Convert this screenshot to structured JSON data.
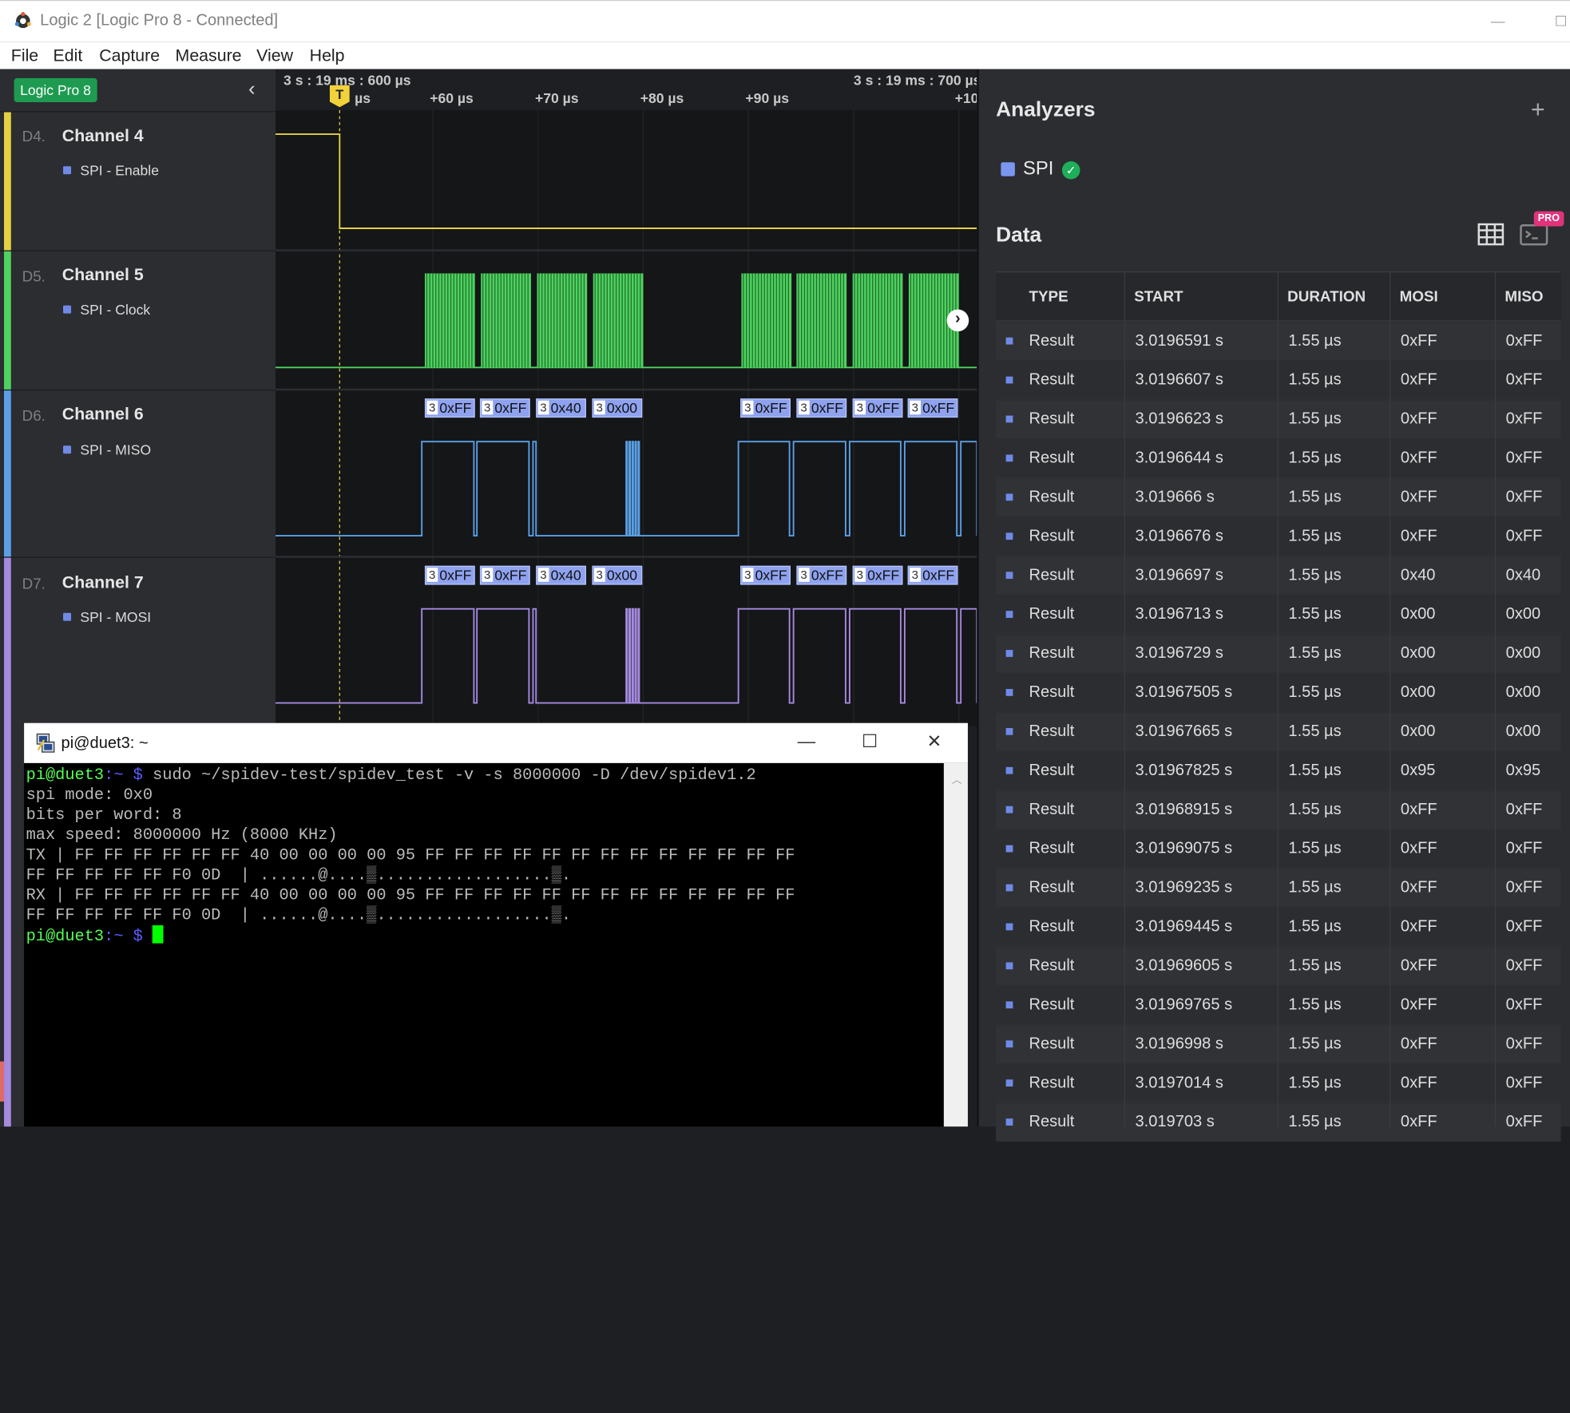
{
  "window": {
    "title": "Logic 2 [Logic Pro 8 - Connected]",
    "minimize": "—",
    "maximize": "☐"
  },
  "menu": [
    "File",
    "Edit",
    "Capture",
    "Measure",
    "View",
    "Help"
  ],
  "device": {
    "badge": "Logic Pro 8",
    "collapse": "‹"
  },
  "timeline": {
    "left_marker": "3 s : 19 ms : 600 µs",
    "right_marker": "3 s : 19 ms : 700 µs",
    "trigger": "T",
    "ticks": [
      "µs",
      "+60 µs",
      "+70 µs",
      "+80 µs",
      "+90 µs",
      "+10"
    ]
  },
  "channels": [
    {
      "id": "D4.",
      "name": "Channel 4",
      "label": "SPI - Enable",
      "color": "#e5d142"
    },
    {
      "id": "D5.",
      "name": "Channel 5",
      "label": "SPI - Clock",
      "color": "#4fd160"
    },
    {
      "id": "D6.",
      "name": "Channel 6",
      "label": "SPI - MISO",
      "color": "#5aa0e6"
    },
    {
      "id": "D7.",
      "name": "Channel 7",
      "label": "SPI - MOSI",
      "color": "#a58ae0"
    }
  ],
  "decoded_pills": {
    "miso": [
      {
        "n": "3",
        "v": "0xFF"
      },
      {
        "n": "3",
        "v": "0xFF"
      },
      {
        "n": "3",
        "v": "0x40"
      },
      {
        "n": "3",
        "v": "0x00"
      },
      {
        "n": "3",
        "v": "0xFF"
      },
      {
        "n": "3",
        "v": "0xFF"
      },
      {
        "n": "3",
        "v": "0xFF"
      },
      {
        "n": "3",
        "v": "0xFF"
      }
    ],
    "mosi": [
      {
        "n": "3",
        "v": "0xFF"
      },
      {
        "n": "3",
        "v": "0xFF"
      },
      {
        "n": "3",
        "v": "0x40"
      },
      {
        "n": "3",
        "v": "0x00"
      },
      {
        "n": "3",
        "v": "0xFF"
      },
      {
        "n": "3",
        "v": "0xFF"
      },
      {
        "n": "3",
        "v": "0xFF"
      },
      {
        "n": "3",
        "v": "0xFF"
      }
    ]
  },
  "analyzers": {
    "title": "Analyzers",
    "add": "+",
    "items": [
      {
        "name": "SPI",
        "status": "✓"
      }
    ]
  },
  "data_panel": {
    "title": "Data",
    "pro_badge": "PRO",
    "columns": [
      "TYPE",
      "START",
      "DURATION",
      "MOSI",
      "MISO"
    ],
    "rows": [
      [
        "Result",
        "3.0196591 s",
        "1.55 µs",
        "0xFF",
        "0xFF"
      ],
      [
        "Result",
        "3.0196607 s",
        "1.55 µs",
        "0xFF",
        "0xFF"
      ],
      [
        "Result",
        "3.0196623 s",
        "1.55 µs",
        "0xFF",
        "0xFF"
      ],
      [
        "Result",
        "3.0196644 s",
        "1.55 µs",
        "0xFF",
        "0xFF"
      ],
      [
        "Result",
        "3.019666 s",
        "1.55 µs",
        "0xFF",
        "0xFF"
      ],
      [
        "Result",
        "3.0196676 s",
        "1.55 µs",
        "0xFF",
        "0xFF"
      ],
      [
        "Result",
        "3.0196697 s",
        "1.55 µs",
        "0x40",
        "0x40"
      ],
      [
        "Result",
        "3.0196713 s",
        "1.55 µs",
        "0x00",
        "0x00"
      ],
      [
        "Result",
        "3.0196729 s",
        "1.55 µs",
        "0x00",
        "0x00"
      ],
      [
        "Result",
        "3.01967505 s",
        "1.55 µs",
        "0x00",
        "0x00"
      ],
      [
        "Result",
        "3.01967665 s",
        "1.55 µs",
        "0x00",
        "0x00"
      ],
      [
        "Result",
        "3.01967825 s",
        "1.55 µs",
        "0x95",
        "0x95"
      ],
      [
        "Result",
        "3.01968915 s",
        "1.55 µs",
        "0xFF",
        "0xFF"
      ],
      [
        "Result",
        "3.01969075 s",
        "1.55 µs",
        "0xFF",
        "0xFF"
      ],
      [
        "Result",
        "3.01969235 s",
        "1.55 µs",
        "0xFF",
        "0xFF"
      ],
      [
        "Result",
        "3.01969445 s",
        "1.55 µs",
        "0xFF",
        "0xFF"
      ],
      [
        "Result",
        "3.01969605 s",
        "1.55 µs",
        "0xFF",
        "0xFF"
      ],
      [
        "Result",
        "3.01969765 s",
        "1.55 µs",
        "0xFF",
        "0xFF"
      ],
      [
        "Result",
        "3.0196998 s",
        "1.55 µs",
        "0xFF",
        "0xFF"
      ],
      [
        "Result",
        "3.0197014 s",
        "1.55 µs",
        "0xFF",
        "0xFF"
      ],
      [
        "Result",
        "3.019703 s",
        "1.55 µs",
        "0xFF",
        "0xFF"
      ]
    ]
  },
  "terminal": {
    "title": "pi@duet3: ~",
    "prompt_user": "pi@duet3",
    "prompt_path": ":~ $",
    "command": " sudo ~/spidev-test/spidev_test -v -s 8000000 -D /dev/spidev1.2",
    "output": [
      "spi mode: 0x0",
      "bits per word: 8",
      "max speed: 8000000 Hz (8000 KHz)",
      "TX | FF FF FF FF FF FF 40 00 00 00 00 95 FF FF FF FF FF FF FF FF FF FF FF FF FF",
      "FF FF FF FF FF F0 0D  | ......@....▒..................▒.",
      "RX | FF FF FF FF FF FF 40 00 00 00 00 95 FF FF FF FF FF FF FF FF FF FF FF FF FF",
      "FF FF FF FF FF F0 0D  | ......@....▒..................▒."
    ],
    "minimize": "—",
    "maximize": "☐",
    "close": "✕"
  }
}
